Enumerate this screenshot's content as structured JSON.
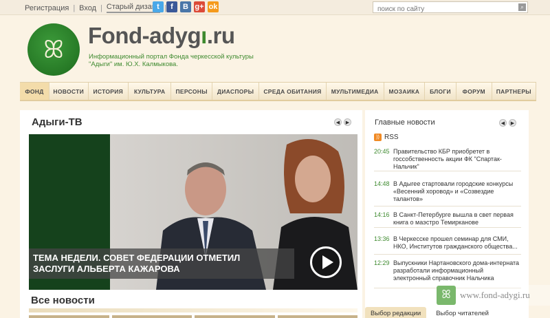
{
  "topbar": {
    "register": "Регистрация",
    "login": "Вход",
    "old_design": "Старый дизайн",
    "search_placeholder": "поиск по сайту"
  },
  "social": [
    {
      "name": "twitter-icon",
      "glyph": "t",
      "color": "#4aa8e8"
    },
    {
      "name": "facebook-icon",
      "glyph": "f",
      "color": "#3b5998"
    },
    {
      "name": "vkontakte-icon",
      "glyph": "B",
      "color": "#4a76a8"
    },
    {
      "name": "google-plus-icon",
      "glyph": "g+",
      "color": "#dc4a38"
    },
    {
      "name": "odnoklassniki-icon",
      "glyph": "ok",
      "color": "#f59a1b"
    }
  ],
  "header": {
    "title_part1": "Fond-adyg",
    "title_part2": ".ru",
    "tagline_line1": "Информационный портал Фонда черкесской культуры",
    "tagline_line2": "\"Адыги\" им. Ю.Х. Калмыкова."
  },
  "nav": [
    "ФОНД",
    "НОВОСТИ",
    "ИСТОРИЯ",
    "КУЛЬТУРА",
    "ПЕРСОНЫ",
    "ДИАСПОРЫ",
    "СРЕДА ОБИТАНИЯ",
    "МУЛЬТИМЕДИА",
    "МОЗАИКА",
    "БЛОГИ",
    "ФОРУМ",
    "ПАРТНЕРЫ"
  ],
  "main": {
    "tv_title": "Адыги-ТВ",
    "video_caption_line1": "ТЕМА НЕДЕЛИ. СОВЕТ ФЕДЕРАЦИИ ОТМЕТИЛ",
    "video_caption_line2": "ЗАСЛУГИ АЛЬБЕРТА КАЖАРОВА",
    "all_news": "Все новости"
  },
  "sidebar": {
    "title": "Главные новости",
    "rss": "RSS",
    "news": [
      {
        "time": "20:45",
        "text": "Правительство КБР приобретет в госсобственность акции ФК \"Спартак-Нальчик\""
      },
      {
        "time": "14:48",
        "text": "В Адыгее стартовали городские конкурсы «Весенний хоровод» и «Созвездие талантов»"
      },
      {
        "time": "14:16",
        "text": "В Санкт-Петербурге вышла в свет первая книга о маэстро Темирканове"
      },
      {
        "time": "13:36",
        "text": "В Черкесске прошел семинар для СМИ, НКО, Институтов гражданского общества..."
      },
      {
        "time": "12:29",
        "text": "Выпускники Нартановского дома-интерната разработали информационный электронный справочник Нальчика"
      }
    ],
    "tabs": [
      "Выбор редакции",
      "Выбор читателей"
    ]
  },
  "watermark": "www.fond-adygi.ru"
}
